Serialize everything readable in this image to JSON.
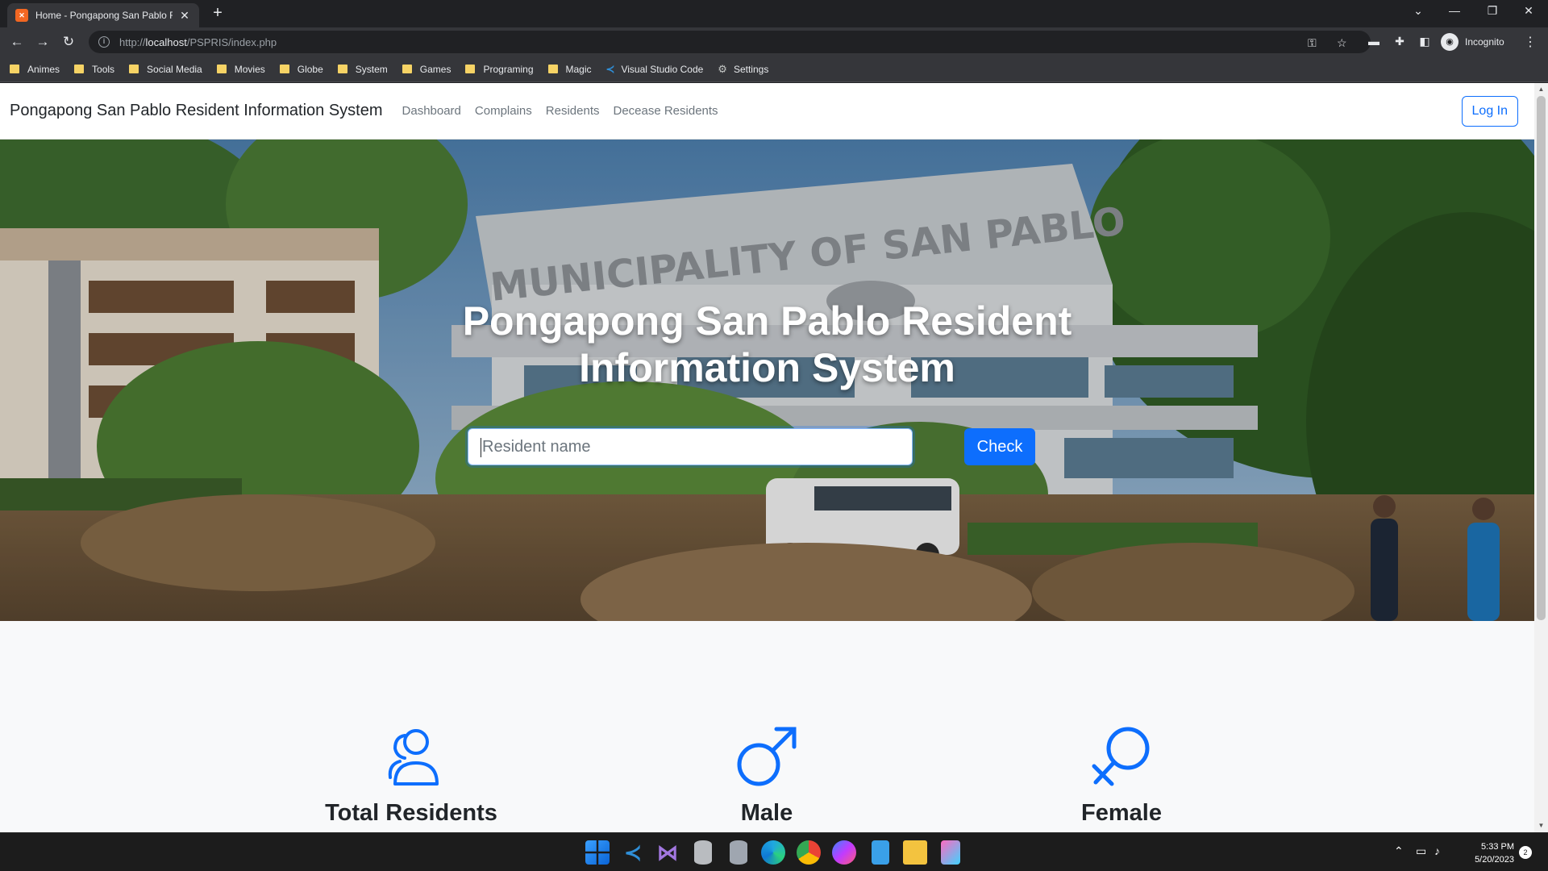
{
  "browser": {
    "tab_title": "Home - Pongapong San Pablo R",
    "tab_close": "✕",
    "new_tab": "+",
    "url_prefix": "http://",
    "url_host": "localhost",
    "url_path": "/PSPRIS/index.php",
    "profile_label": "Incognito"
  },
  "bookmarks": [
    {
      "label": "Animes",
      "icon": "folder-icon"
    },
    {
      "label": "Tools",
      "icon": "folder-icon"
    },
    {
      "label": "Social Media",
      "icon": "folder-icon"
    },
    {
      "label": "Movies",
      "icon": "folder-icon"
    },
    {
      "label": "Globe",
      "icon": "folder-icon"
    },
    {
      "label": "System",
      "icon": "folder-icon"
    },
    {
      "label": "Games",
      "icon": "folder-icon"
    },
    {
      "label": "Programing",
      "icon": "folder-icon"
    },
    {
      "label": "Magic",
      "icon": "folder-icon"
    },
    {
      "label": "Visual Studio Code",
      "icon": "vscode-icon"
    },
    {
      "label": "Settings",
      "icon": "gear-icon"
    }
  ],
  "site": {
    "brand": "Pongapong San Pablo Resident Information System",
    "nav": [
      "Dashboard",
      "Complains",
      "Residents",
      "Decease Residents"
    ],
    "login_label": "Log In"
  },
  "hero": {
    "title": "Pongapong San Pablo Resident Information System",
    "search_placeholder": "Resident name",
    "check_label": "Check",
    "building_sign": "MUNICIPALITY OF SAN PABLO"
  },
  "stats": [
    {
      "label": "Total Residents",
      "icon": "users-icon"
    },
    {
      "label": "Male",
      "icon": "male-icon"
    },
    {
      "label": "Female",
      "icon": "female-icon"
    }
  ],
  "taskbar": {
    "time": "5:33 PM",
    "date": "5/20/2023",
    "notifications": "2"
  },
  "colors": {
    "primary": "#0d6efd",
    "chrome_dark": "#202124",
    "chrome_toolbar": "#35363a",
    "page_bg": "#f8f9fa"
  }
}
